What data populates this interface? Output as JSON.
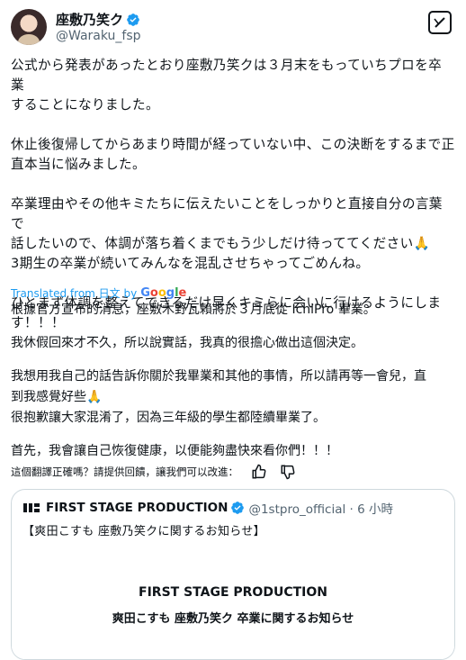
{
  "author": {
    "display_name": "座敷乃笑ク",
    "handle": "@Waraku_fsp",
    "verified": true
  },
  "tweet": {
    "paragraphs": [
      "公式から発表があったとおり座敷乃笑クは３月末をもっていちプロを卒業\nすることになりました。",
      "休止後復帰してからあまり時間が経っていない中、この決断をするまで正\n直本当に悩みました。",
      "卒業理由やその他キミたちに伝えたいことをしっかりと直接自分の言葉で\n話したいので、体調が落ち着くまでもう少しだけ待っててください🙏\n3期生の卒業が続いてみんなを混乱させちゃってごめんね。",
      "ひとまず体調を整えてできるだけ早くキミらに会いに行けるようにしま\nす！！！"
    ]
  },
  "translation_banner": {
    "label": "Translated from 日文 by",
    "provider": "Google"
  },
  "translation": {
    "paragraphs": [
      "根據官方宣布的消息，座敷木野瓦賴將於３月底從 IchiPro 畢業。",
      "我休假回來才不久，所以說實話，我真的很擔心做出這個決定。",
      "我想用我自己的話告訴你關於我畢業和其他的事情，所以請再等一會兒，直\n到我感覺好些🙏\n很抱歉讓大家混淆了，因為三年級的學生都陸續畢業了。",
      "首先，我會讓自己恢復健康，以便能夠盡快來看你們！！！"
    ]
  },
  "feedback": {
    "prompt": "這個翻譯正確嗎？請提供回饋，讓我們可以改進：",
    "icons": [
      "thumbs-up-icon",
      "thumbs-down-icon"
    ]
  },
  "quoted_tweet": {
    "display_name": "FIRST STAGE PRODUCTION",
    "handle_time": "@1stpro_official · 6 小時",
    "text": "【爽田こすも 座敷乃笑クに関するお知らせ】",
    "media_title": "FIRST STAGE PRODUCTION",
    "media_subtitle": "爽田こすも 座敷乃笑ク 卒業に関するお知らせ"
  },
  "colors": {
    "verified_blue": "#1d9bf0",
    "link_blue": "#1d9bf0",
    "secondary_text": "#536471",
    "border": "#cfd9de"
  }
}
